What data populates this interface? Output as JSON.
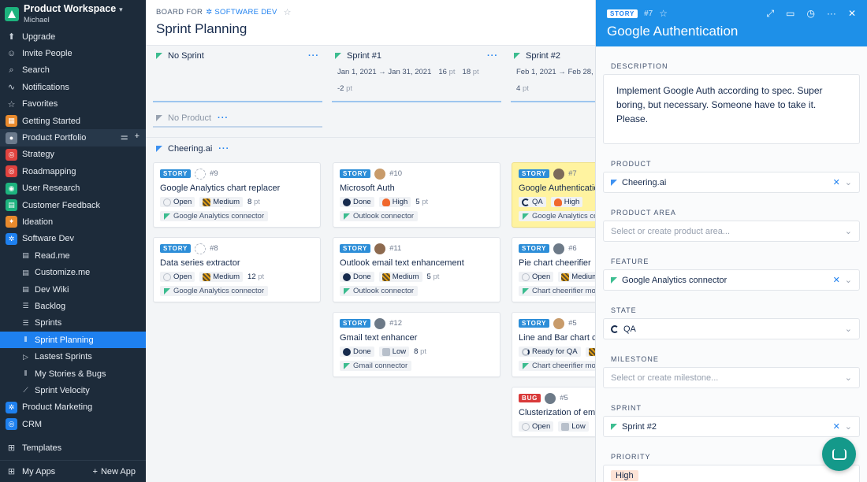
{
  "workspace": {
    "name": "Product Workspace",
    "user": "Michael"
  },
  "sidebar": {
    "top": [
      {
        "label": "Upgrade",
        "icon": "upgrade-icon"
      },
      {
        "label": "Invite People",
        "icon": "invite-people-icon"
      },
      {
        "label": "Search",
        "icon": "search-icon"
      },
      {
        "label": "Notifications",
        "icon": "bell-icon"
      },
      {
        "label": "Favorites",
        "icon": "star-icon"
      }
    ],
    "apps": [
      {
        "label": "Getting Started",
        "color": "#e88a2d"
      },
      {
        "label": "Product Portfolio",
        "color": "#6b7a8c"
      },
      {
        "label": "Strategy",
        "color": "#e0433f"
      },
      {
        "label": "Roadmapping",
        "color": "#e0433f"
      },
      {
        "label": "User Research",
        "color": "#1db37e"
      },
      {
        "label": "Customer Feedback",
        "color": "#1db37e"
      },
      {
        "label": "Ideation",
        "color": "#e88a2d"
      },
      {
        "label": "Software Dev",
        "color": "#1e80ef"
      }
    ],
    "software_dev_items": [
      "Read.me",
      "Customize.me",
      "Dev Wiki",
      "Backlog",
      "Sprints",
      "Sprint Planning",
      "Lastest Sprints",
      "My Stories & Bugs",
      "Sprint Velocity"
    ],
    "more_apps": [
      {
        "label": "Product Marketing",
        "color": "#1e80ef"
      },
      {
        "label": "CRM",
        "color": "#1e80ef"
      }
    ],
    "templates": "Templates",
    "my_apps": "My Apps",
    "new_app": "New App"
  },
  "board": {
    "crumb_prefix": "BOARD FOR",
    "crumb_link": "SOFTWARE DEV",
    "title": "Sprint Planning",
    "sprints": [
      {
        "name": "No Sprint"
      },
      {
        "name": "Sprint #1",
        "dates": "Jan 1, 2021 → Jan 31, 2021",
        "pts_a": "16",
        "pts_b": "18",
        "delta": "-2",
        "unit": "pt"
      },
      {
        "name": "Sprint #2",
        "dates": "Feb 1, 2021 → Feb 28, 20",
        "delta": "4",
        "unit": "pt"
      }
    ],
    "no_product": "No Product",
    "group": "Cheering.ai",
    "cards": [
      {
        "type": "STORY",
        "num": "#9",
        "title": "Google Analytics chart replacer",
        "state": "Open",
        "priority": "Medium",
        "points": "8",
        "feature": "Google Analytics connector"
      },
      {
        "type": "STORY",
        "num": "#8",
        "title": "Data series extractor",
        "state": "Open",
        "priority": "Medium",
        "points": "12",
        "feature": "Google Analytics connector"
      },
      {
        "type": "STORY",
        "num": "#10",
        "title": "Microsoft Auth",
        "state": "Done",
        "priority": "High",
        "points": "5",
        "feature": "Outlook connector"
      },
      {
        "type": "STORY",
        "num": "#11",
        "title": "Outlook email text enhancement",
        "state": "Done",
        "priority": "Medium",
        "points": "5",
        "feature": "Outlook connector"
      },
      {
        "type": "STORY",
        "num": "#12",
        "title": "Gmail text enhancer",
        "state": "Done",
        "priority": "Low",
        "points": "8",
        "feature": "Gmail connector"
      },
      {
        "type": "STORY",
        "num": "#7",
        "title": "Google Authentication",
        "state": "QA",
        "priority": "High",
        "feature": "Google Analytics conn"
      },
      {
        "type": "STORY",
        "num": "#6",
        "title": "Pie chart cheerifier",
        "state": "Open",
        "priority": "Medium",
        "feature": "Chart cheerifier moc"
      },
      {
        "type": "STORY",
        "num": "#5",
        "title": "Line and Bar chart ch",
        "state": "Ready for QA",
        "feature": "Chart cheerifier moc"
      },
      {
        "type": "BUG",
        "num": "#5",
        "title": "Clusterization of emo",
        "state": "Open",
        "priority": "Low"
      }
    ],
    "pt_unit": "pt"
  },
  "panel": {
    "type": "STORY",
    "num": "#7",
    "title": "Google Authentication",
    "description_label": "DESCRIPTION",
    "description": "Implement Google Auth according to spec. Super boring, but necessary. Someone have to take it. Please.",
    "product_label": "PRODUCT",
    "product": "Cheering.ai",
    "product_area_label": "PRODUCT AREA",
    "product_area_placeholder": "Select or create product area...",
    "feature_label": "FEATURE",
    "feature": "Google Analytics connector",
    "state_label": "STATE",
    "state": "QA",
    "milestone_label": "MILESTONE",
    "milestone_placeholder": "Select or create milestone...",
    "sprint_label": "SPRINT",
    "sprint": "Sprint #2",
    "priority_label": "PRIORITY",
    "priority": "High"
  },
  "colors": {
    "sidebar": "#1d2b3a",
    "accent": "#1e80ef",
    "panel_header": "#1e90e8",
    "highlight_card": "#fff3a0",
    "chat": "#14998a"
  }
}
